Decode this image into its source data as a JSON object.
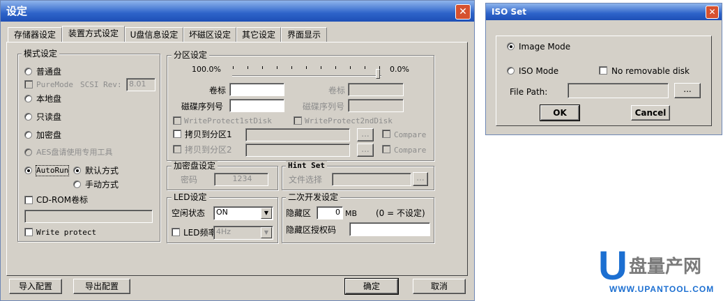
{
  "main_dialog": {
    "title": "设定",
    "tabs": [
      "存储器设定",
      "装置方式设定",
      "U盘信息设定",
      "坏磁区设定",
      "其它设定",
      "界面显示"
    ],
    "mode_group": {
      "title": "模式设定",
      "normal_disk": "普通盘",
      "puremode": "PureMode",
      "scsi_rev_label": "SCSI Rev:",
      "scsi_rev_value": "8.01",
      "local_disk": "本地盘",
      "readonly_disk": "只读盘",
      "encrypted_disk": "加密盘",
      "aes_note": "AES盘请使用专用工具",
      "autorun": "AutoRun",
      "default_mode": "默认方式",
      "manual_mode": "手动方式",
      "cdrom_label": "CD-ROM卷标",
      "write_protect": "Write protect"
    },
    "partition_group": {
      "title": "分区设定",
      "left_pct": "100.0%",
      "right_pct": "0.0%",
      "volume_label": "卷标",
      "volume_label2": "卷标",
      "serial_label": "磁碟序列号",
      "serial_label2": "磁碟序列号",
      "wp1": "WriteProtect1stDisk",
      "wp2": "WriteProtect2ndDisk",
      "copy1": "拷贝到分区1",
      "copy2": "拷贝到分区2",
      "compare": "Compare",
      "browse": "..."
    },
    "encrypt_group": {
      "title": "加密盘设定",
      "password_label": "密码",
      "password_value": "1234"
    },
    "hint_group": {
      "title": "Hint Set",
      "file_label": "文件选择",
      "browse": "..."
    },
    "led_group": {
      "title": "LED设定",
      "idle_label": "空闲状态",
      "idle_value": "ON",
      "freq_label": "LED频率",
      "freq_value": "4Hz"
    },
    "dev_group": {
      "title": "二次开发设定",
      "hidden_label": "隐藏区",
      "hidden_value": "0",
      "hidden_unit": "MB",
      "hidden_note": "(0 = 不设定)",
      "auth_label": "隐藏区授权码"
    },
    "buttons": {
      "import": "导入配置",
      "export": "导出配置",
      "ok": "确定",
      "cancel": "取消"
    }
  },
  "iso_dialog": {
    "title": "ISO Set",
    "image_mode": "Image Mode",
    "iso_mode": "ISO Mode",
    "no_removable": "No removable disk",
    "file_path_label": "File Path:",
    "browse": "...",
    "ok": "OK",
    "cancel": "Cancel"
  },
  "watermark": {
    "logo_letter": "U",
    "logo_text": "盘量产网",
    "url": "WWW.UPANTOOL.COM"
  },
  "colors": {
    "title_blue": "#2d63c9",
    "close_red": "#d6512f",
    "dialog_gray": "#d4d0c8",
    "logo_blue": "#1c6fd1"
  }
}
